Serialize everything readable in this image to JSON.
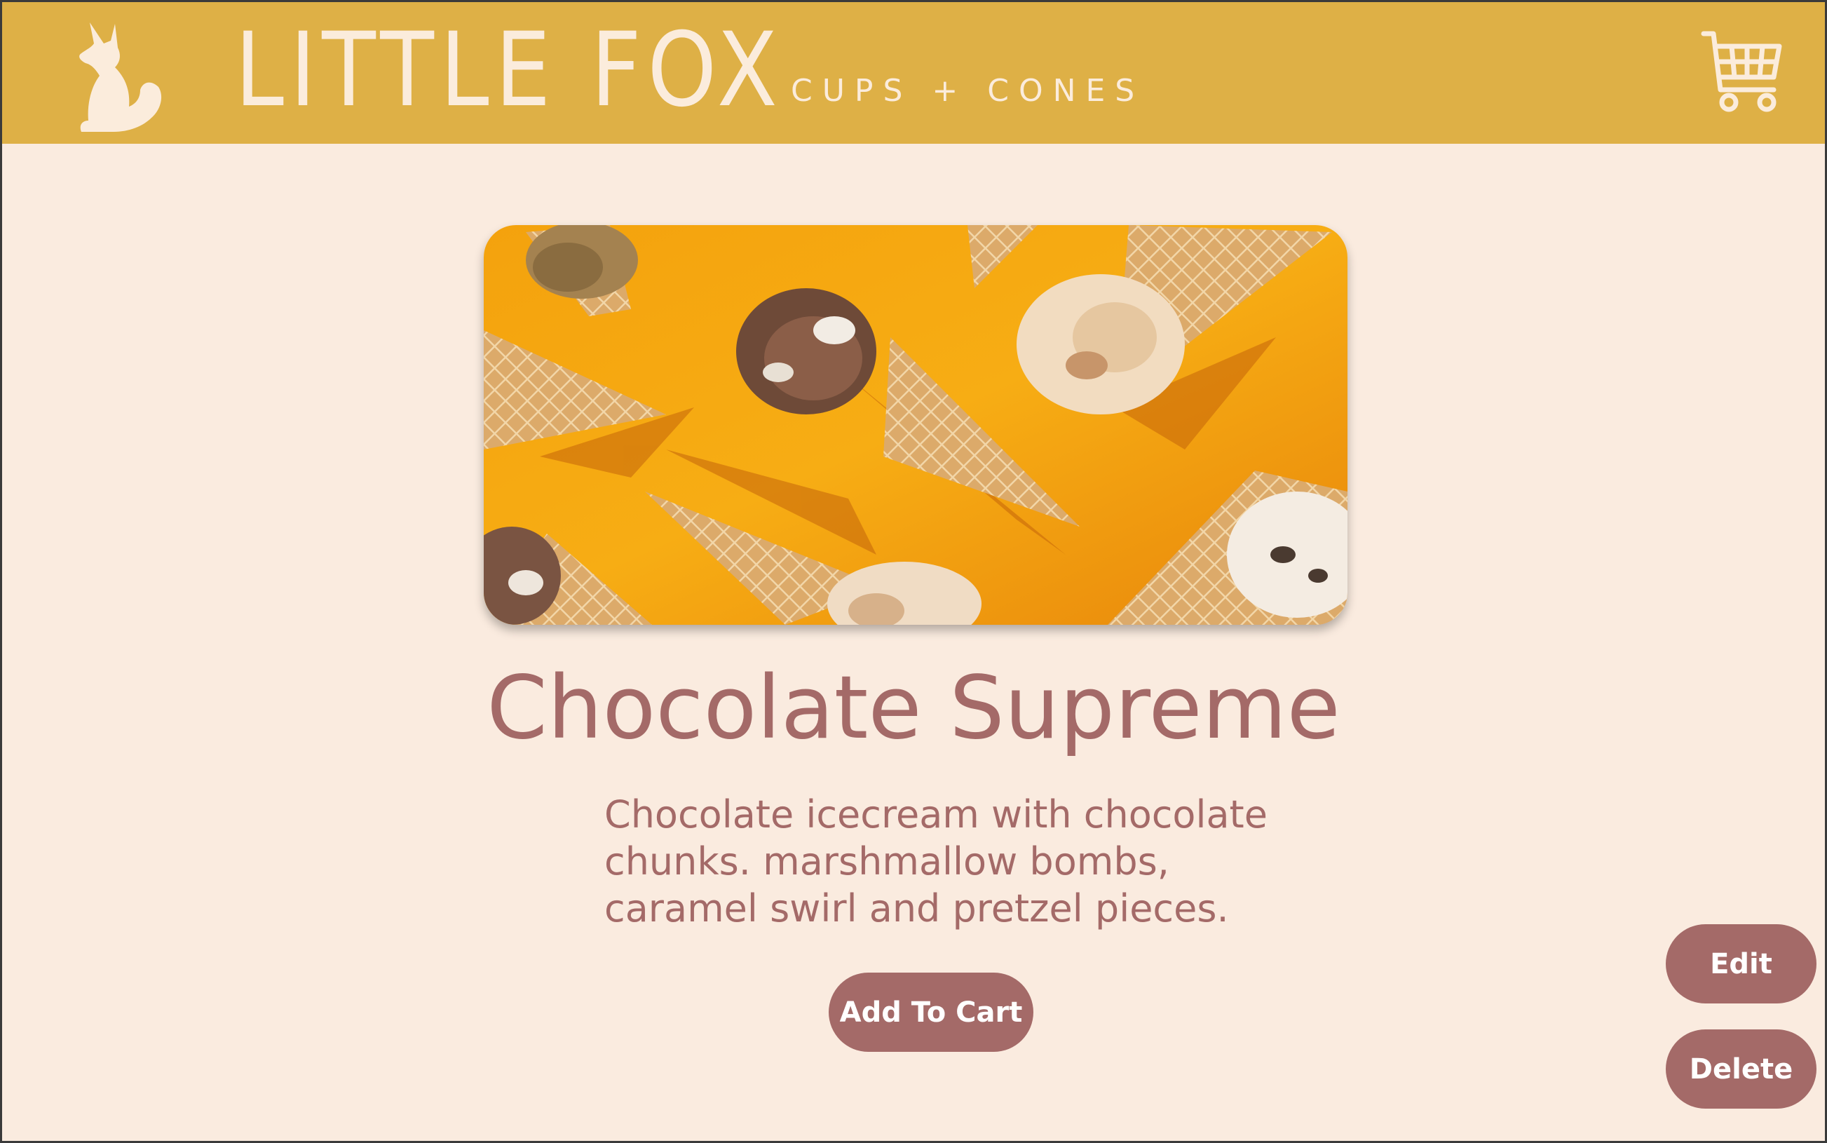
{
  "header": {
    "brand_title": "LITTLE FOX",
    "brand_tagline": "CUPS + CONES",
    "background_color": "#deb046",
    "logo_icon": "fox-silhouette-icon",
    "cart_icon": "shopping-cart-icon"
  },
  "product": {
    "image_alt": "Ice cream cones on an orange background",
    "title": "Chocolate Supreme",
    "description": "Chocolate icecream with chocolate chunks. marshmallow bombs, caramel swirl and pretzel pieces.",
    "add_to_cart_label": "Add To Cart"
  },
  "admin": {
    "edit_label": "Edit",
    "delete_label": "Delete"
  },
  "colors": {
    "page_background": "#faebdf",
    "accent": "#a46a68",
    "header_text": "#fbecdc"
  }
}
